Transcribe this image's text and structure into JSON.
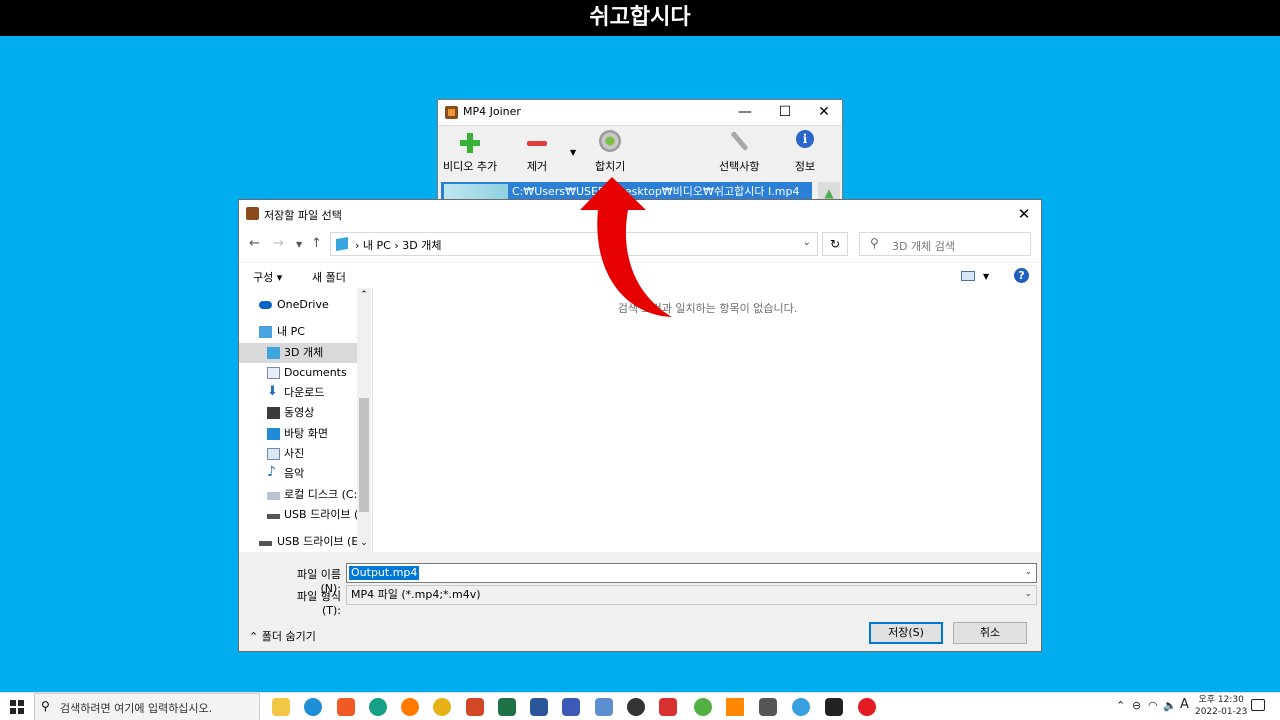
{
  "banner": {
    "title": "쉬고합시다"
  },
  "joiner": {
    "title": "MP4 Joiner",
    "toolbar": {
      "add_video": "비디오 추가",
      "remove": "제거",
      "join": "합치기",
      "options": "선택사항",
      "info": "정보"
    },
    "file_path": "C:₩Users₩USER₩Desktop₩비디오₩쉬고합시다 I.mp4",
    "window_controls": {
      "minimize": "—",
      "maximize": "☐",
      "close": "✕"
    }
  },
  "dialog": {
    "title": "저장할 파일 선택",
    "address": {
      "root": "내 PC",
      "folder": "3D 개체"
    },
    "search_placeholder": "3D 개체 검색",
    "commands": {
      "organize": "구성 ▾",
      "new_folder": "새 폴더"
    },
    "nav_items": [
      {
        "label": "OneDrive",
        "icon": "cloud-icon"
      },
      {
        "label": "내 PC",
        "icon": "pc-icon"
      },
      {
        "label": "3D 개체",
        "icon": "3d-objects-icon"
      },
      {
        "label": "Documents",
        "icon": "document-icon"
      },
      {
        "label": "다운로드",
        "icon": "download-icon"
      },
      {
        "label": "동영상",
        "icon": "video-icon"
      },
      {
        "label": "바탕 화면",
        "icon": "desktop-icon"
      },
      {
        "label": "사진",
        "icon": "picture-icon"
      },
      {
        "label": "음악",
        "icon": "music-icon"
      },
      {
        "label": "로컬 디스크 (C:)",
        "icon": "disk-icon"
      },
      {
        "label": "USB 드라이브 (E:)",
        "icon": "usb-icon"
      },
      {
        "label": "USB 드라이브 (E:)",
        "icon": "usb-icon"
      }
    ],
    "empty_message": "검색 조건과 일치하는 항목이 없습니다.",
    "filename_label": "파일 이름(N):",
    "filename_value": "Output.mp4",
    "filetype_label": "파일 형식(T):",
    "filetype_value": "MP4 파일 (*.mp4;*.m4v)",
    "hide_folders": "폴더 숨기기",
    "save_button": "저장(S)",
    "cancel_button": "취소"
  },
  "taskbar": {
    "search_placeholder": "검색하려면 여기에 입력하십시오.",
    "ime": "A",
    "time": "오후 12:30",
    "date": "2022-01-23"
  },
  "colors": {
    "desktop": "#00adef",
    "selection": "#0078d7",
    "arrow": "#e60000"
  }
}
